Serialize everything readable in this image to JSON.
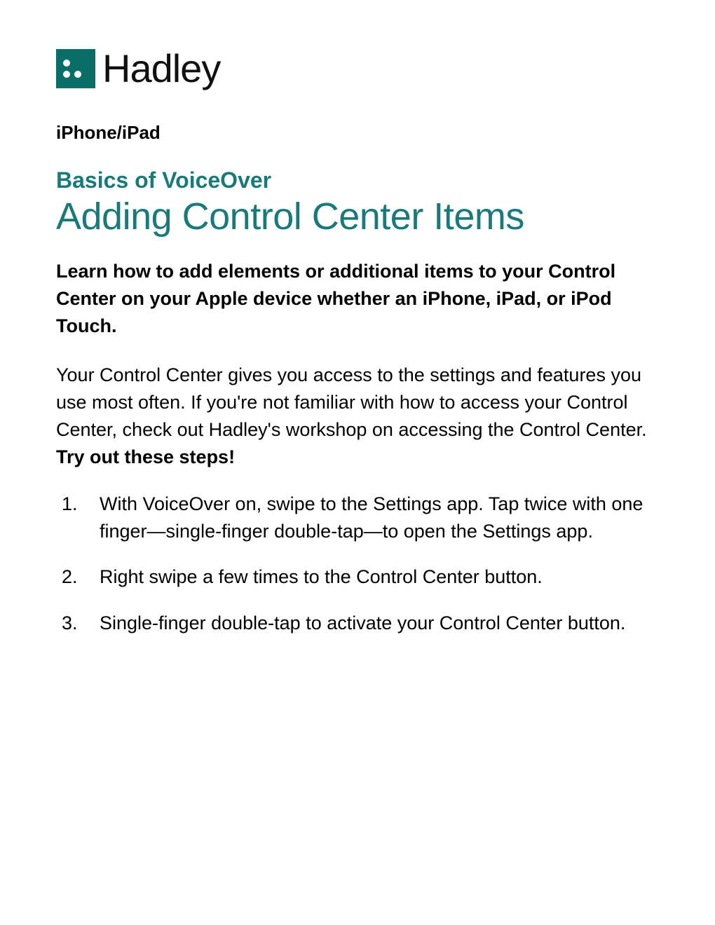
{
  "logo": {
    "brand_text": "Hadley"
  },
  "category": "iPhone/iPad",
  "subtitle": "Basics of VoiceOver",
  "title": "Adding Control Center Items",
  "lead": "Learn how to add elements or additional items to your Control Center on your Apple device whether an iPhone, iPad, or iPod Touch.",
  "intro_plain": "Your Control Center gives you access to the settings and features you use most often. If you're not familiar with how to access your Control Center, check out Hadley's workshop on accessing the Control Center. ",
  "intro_bold": "Try out these steps!",
  "steps": [
    "With VoiceOver on, swipe to the Settings app. Tap twice with one finger—single-finger double-tap—to open the Settings app.",
    "Right swipe a few times to the Control Center button.",
    "Single-finger double-tap to activate your Control Center button."
  ]
}
